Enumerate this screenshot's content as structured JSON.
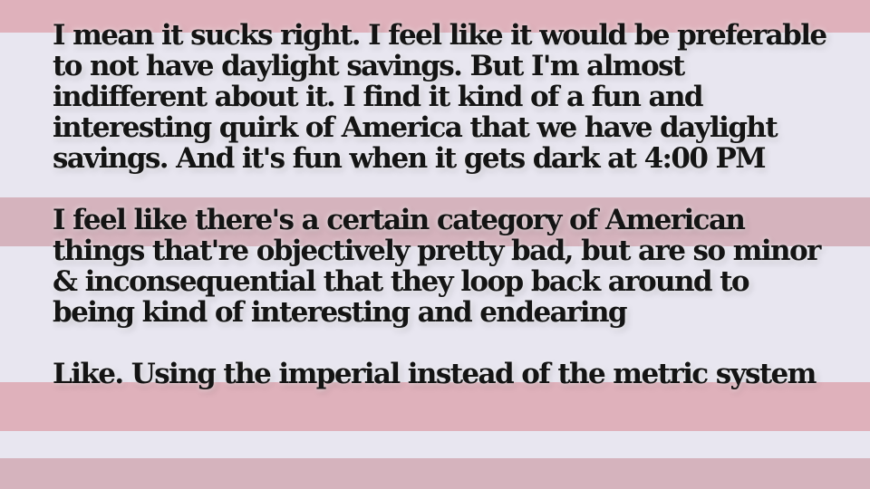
{
  "paragraphs": [
    {
      "lines": [
        "I mean it sucks right. I feel like it would be preferable",
        "to not have daylight savings. But I'm almost",
        "indifferent about it. I find it kind of a fun and",
        "interesting quirk of America that we have daylight",
        "savings. And it's fun when it gets dark at 4:00 PM"
      ]
    },
    {
      "lines": [
        "I feel like there's a certain category of American",
        "things that're objectively pretty bad, but are so minor",
        "& inconsequential that they loop back around to",
        "being kind of interesting and endearing"
      ]
    },
    {
      "lines": [
        "Like. Using the imperial instead of the metric system"
      ]
    }
  ],
  "colors": {
    "stripe_pink": "#dfb1bb",
    "stripe_mauve": "#d5b3bd",
    "stripe_light": "#e8e6f0",
    "text": "#141414"
  }
}
